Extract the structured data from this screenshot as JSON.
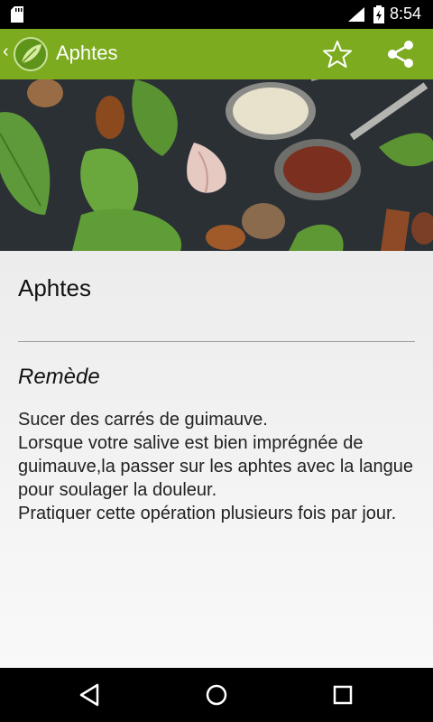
{
  "status_bar": {
    "time": "8:54",
    "icons": [
      "sd-card-icon",
      "signal-icon",
      "battery-icon"
    ]
  },
  "app_bar": {
    "title": "Aphtes",
    "icons": [
      "back-chevron-icon",
      "leaf-logo-icon",
      "star-icon",
      "share-icon"
    ]
  },
  "hero": {
    "description_icon": "spices-and-herbs-photo"
  },
  "content": {
    "heading": "Aphtes",
    "section_title": "Remède",
    "remedy_lines": [
      "Sucer des carrés de guimauve.",
      "Lorsque votre salive est bien imprégnée de guimauve,la passer sur les aphtes avec la langue pour soulager la douleur.",
      "Pratiquer cette opération plusieurs fois par jour."
    ]
  },
  "nav_bar": {
    "icons": [
      "back-triangle-icon",
      "home-circle-icon",
      "recents-square-icon"
    ]
  },
  "colors": {
    "app_bar": "#7cab1f",
    "status_bar": "#000000",
    "content_bg": "#f3f3f3"
  }
}
